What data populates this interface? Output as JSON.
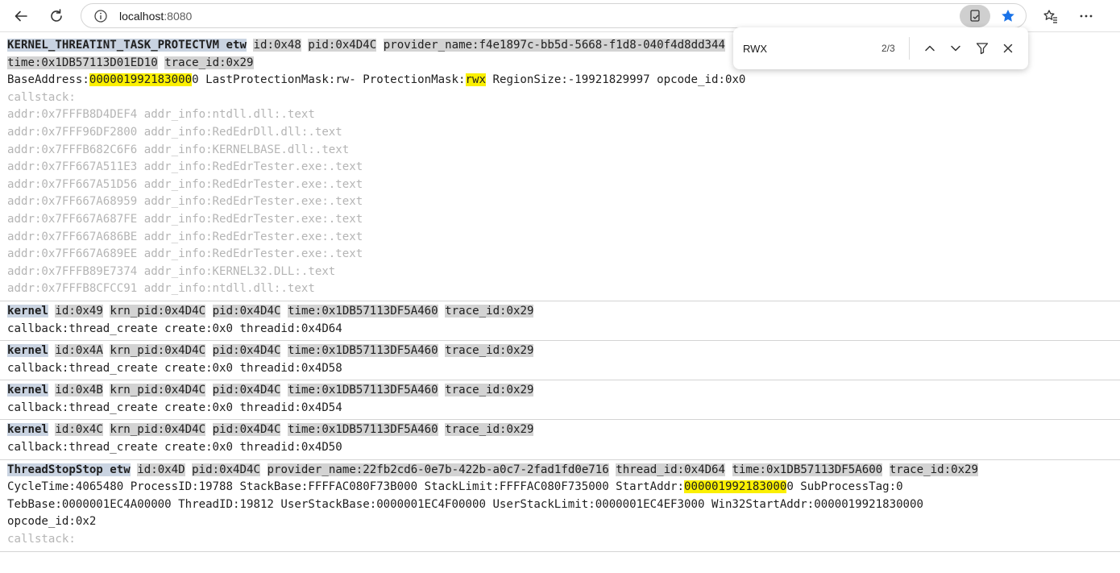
{
  "browser": {
    "url_host": "localhost",
    "url_port": ":8080",
    "icons": [
      "back-icon",
      "refresh-icon",
      "info-icon",
      "immersive-reader-icon",
      "star-icon",
      "favorites-icon",
      "more-icon"
    ]
  },
  "find": {
    "query": "RWX",
    "count": "2/3"
  },
  "entries": [
    {
      "lines": [
        [
          {
            "t": "KERNEL_THREATINT_TASK_PROTECTVM etw",
            "c": "type"
          },
          {
            "t": " "
          },
          {
            "t": "id:0x48",
            "c": "tag"
          },
          {
            "t": " "
          },
          {
            "t": "pid:0x4D4C",
            "c": "tag"
          },
          {
            "t": " "
          },
          {
            "t": "provider_name:f4e1897c-bb5d-5668-f1d8-040f4d8dd344",
            "c": "tag"
          }
        ],
        [
          {
            "t": "time:0x1DB57113D01ED10",
            "c": "tag"
          },
          {
            "t": " "
          },
          {
            "t": "trace_id:0x29",
            "c": "tag"
          }
        ],
        [
          {
            "t": "BaseAddress:"
          },
          {
            "t": "000001992183000",
            "c": "hl"
          },
          {
            "t": "0 LastProtectionMask:rw- ProtectionMask:"
          },
          {
            "t": "rwx",
            "c": "hl"
          },
          {
            "t": " RegionSize:-19921829997 opcode_id:0x0"
          }
        ],
        [
          {
            "t": "callstack:",
            "c": "cs"
          }
        ],
        [
          {
            "t": "addr:0x7FFFB8D4DEF4 addr_info:ntdll.dll:.text",
            "c": "cs"
          }
        ],
        [
          {
            "t": "addr:0x7FFF96DF2800 addr_info:RedEdrDll.dll:.text",
            "c": "cs"
          }
        ],
        [
          {
            "t": "addr:0x7FFFB682C6F6 addr_info:KERNELBASE.dll:.text",
            "c": "cs"
          }
        ],
        [
          {
            "t": "addr:0x7FF667A511E3 addr_info:RedEdrTester.exe:.text",
            "c": "cs"
          }
        ],
        [
          {
            "t": "addr:0x7FF667A51D56 addr_info:RedEdrTester.exe:.text",
            "c": "cs"
          }
        ],
        [
          {
            "t": "addr:0x7FF667A68959 addr_info:RedEdrTester.exe:.text",
            "c": "cs"
          }
        ],
        [
          {
            "t": "addr:0x7FF667A687FE addr_info:RedEdrTester.exe:.text",
            "c": "cs"
          }
        ],
        [
          {
            "t": "addr:0x7FF667A686BE addr_info:RedEdrTester.exe:.text",
            "c": "cs"
          }
        ],
        [
          {
            "t": "addr:0x7FF667A689EE addr_info:RedEdrTester.exe:.text",
            "c": "cs"
          }
        ],
        [
          {
            "t": "addr:0x7FFFB89E7374 addr_info:KERNEL32.DLL:.text",
            "c": "cs"
          }
        ],
        [
          {
            "t": "addr:0x7FFFB8CFCC91 addr_info:ntdll.dll:.text",
            "c": "cs"
          }
        ]
      ]
    },
    {
      "lines": [
        [
          {
            "t": "kernel",
            "c": "type"
          },
          {
            "t": " "
          },
          {
            "t": "id:0x49",
            "c": "tag"
          },
          {
            "t": " "
          },
          {
            "t": "krn_pid:0x4D4C",
            "c": "tag"
          },
          {
            "t": " "
          },
          {
            "t": "pid:0x4D4C",
            "c": "tag"
          },
          {
            "t": " "
          },
          {
            "t": "time:0x1DB57113DF5A460",
            "c": "tag"
          },
          {
            "t": " "
          },
          {
            "t": "trace_id:0x29",
            "c": "tag"
          }
        ],
        [
          {
            "t": "callback:thread_create create:0x0 threadid:0x4D64"
          }
        ]
      ]
    },
    {
      "lines": [
        [
          {
            "t": "kernel",
            "c": "type"
          },
          {
            "t": " "
          },
          {
            "t": "id:0x4A",
            "c": "tag"
          },
          {
            "t": " "
          },
          {
            "t": "krn_pid:0x4D4C",
            "c": "tag"
          },
          {
            "t": " "
          },
          {
            "t": "pid:0x4D4C",
            "c": "tag"
          },
          {
            "t": " "
          },
          {
            "t": "time:0x1DB57113DF5A460",
            "c": "tag"
          },
          {
            "t": " "
          },
          {
            "t": "trace_id:0x29",
            "c": "tag"
          }
        ],
        [
          {
            "t": "callback:thread_create create:0x0 threadid:0x4D58"
          }
        ]
      ]
    },
    {
      "lines": [
        [
          {
            "t": "kernel",
            "c": "type"
          },
          {
            "t": " "
          },
          {
            "t": "id:0x4B",
            "c": "tag"
          },
          {
            "t": " "
          },
          {
            "t": "krn_pid:0x4D4C",
            "c": "tag"
          },
          {
            "t": " "
          },
          {
            "t": "pid:0x4D4C",
            "c": "tag"
          },
          {
            "t": " "
          },
          {
            "t": "time:0x1DB57113DF5A460",
            "c": "tag"
          },
          {
            "t": " "
          },
          {
            "t": "trace_id:0x29",
            "c": "tag"
          }
        ],
        [
          {
            "t": "callback:thread_create create:0x0 threadid:0x4D54"
          }
        ]
      ]
    },
    {
      "lines": [
        [
          {
            "t": "kernel",
            "c": "type"
          },
          {
            "t": " "
          },
          {
            "t": "id:0x4C",
            "c": "tag"
          },
          {
            "t": " "
          },
          {
            "t": "krn_pid:0x4D4C",
            "c": "tag"
          },
          {
            "t": " "
          },
          {
            "t": "pid:0x4D4C",
            "c": "tag"
          },
          {
            "t": " "
          },
          {
            "t": "time:0x1DB57113DF5A460",
            "c": "tag"
          },
          {
            "t": " "
          },
          {
            "t": "trace_id:0x29",
            "c": "tag"
          }
        ],
        [
          {
            "t": "callback:thread_create create:0x0 threadid:0x4D50"
          }
        ]
      ]
    },
    {
      "lines": [
        [
          {
            "t": "ThreadStopStop etw",
            "c": "type"
          },
          {
            "t": " "
          },
          {
            "t": "id:0x4D",
            "c": "tag"
          },
          {
            "t": " "
          },
          {
            "t": "pid:0x4D4C",
            "c": "tag"
          },
          {
            "t": " "
          },
          {
            "t": "provider_name:22fb2cd6-0e7b-422b-a0c7-2fad1fd0e716",
            "c": "tag"
          },
          {
            "t": " "
          },
          {
            "t": "thread_id:0x4D64",
            "c": "tag"
          },
          {
            "t": " "
          },
          {
            "t": "time:0x1DB57113DF5A600",
            "c": "tag"
          },
          {
            "t": " "
          },
          {
            "t": "trace_id:0x29",
            "c": "tag"
          }
        ],
        [
          {
            "t": "CycleTime:4065480 ProcessID:19788 StackBase:FFFFAC080F73B000 StackLimit:FFFFAC080F735000 StartAddr:"
          },
          {
            "t": "000001992183000",
            "c": "hl"
          },
          {
            "t": "0 SubProcessTag:0"
          }
        ],
        [
          {
            "t": "TebBase:0000001EC4A00000 ThreadID:19812 UserStackBase:0000001EC4F00000 UserStackLimit:0000001EC4EF3000 Win32StartAddr:0000019921830000"
          }
        ],
        [
          {
            "t": "opcode_id:0x2"
          }
        ],
        [
          {
            "t": "callstack:",
            "c": "cs"
          }
        ]
      ]
    }
  ]
}
